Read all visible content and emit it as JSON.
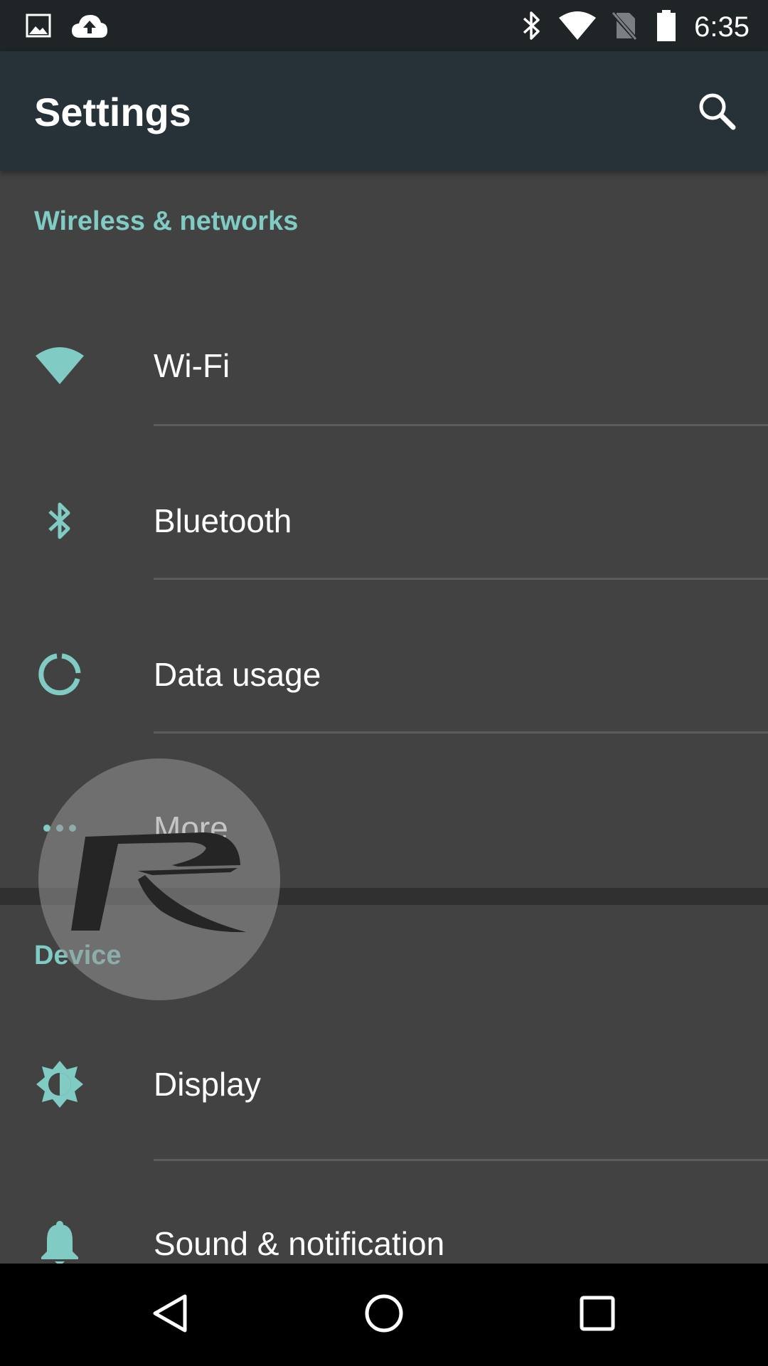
{
  "status_bar": {
    "time": "6:35",
    "left_icons": [
      "image-icon",
      "cloud-upload-icon"
    ],
    "right_icons": [
      "bluetooth-icon",
      "wifi-icon",
      "no-sim-icon",
      "battery-icon"
    ]
  },
  "toolbar": {
    "title": "Settings",
    "search_icon": "search-icon"
  },
  "sections": [
    {
      "header": "Wireless & networks",
      "items": [
        {
          "label": "Wi-Fi",
          "icon": "wifi-icon"
        },
        {
          "label": "Bluetooth",
          "icon": "bluetooth-icon"
        },
        {
          "label": "Data usage",
          "icon": "data-usage-icon"
        },
        {
          "label": "More",
          "icon": "more-horiz-icon"
        }
      ]
    },
    {
      "header": "Device",
      "items": [
        {
          "label": "Display",
          "icon": "brightness-icon"
        },
        {
          "label": "Sound & notification",
          "icon": "bell-icon"
        }
      ]
    }
  ],
  "nav_bar": {
    "buttons": [
      "back-icon",
      "home-icon",
      "recents-icon"
    ]
  },
  "colors": {
    "accent": "#80cbc4",
    "background": "#424242",
    "toolbar": "#263238",
    "status_bar": "#1f2427",
    "nav_bar": "#000000"
  }
}
